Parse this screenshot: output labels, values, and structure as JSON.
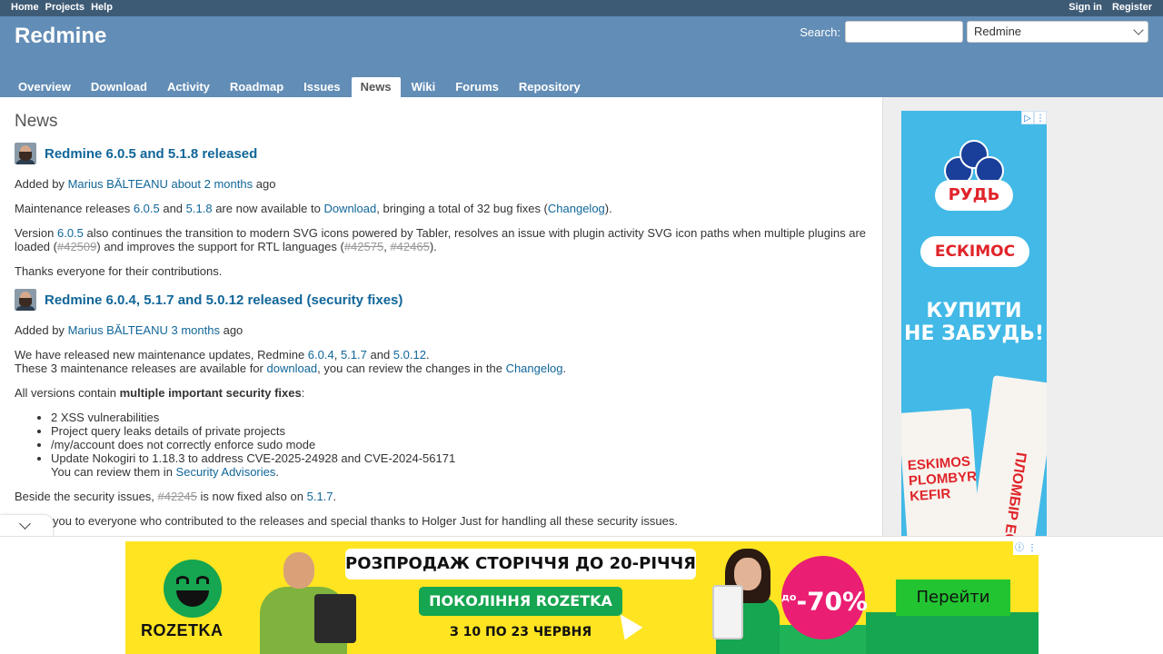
{
  "top_menu": {
    "left": [
      "Home",
      "Projects",
      "Help"
    ],
    "right": [
      "Sign in",
      "Register"
    ]
  },
  "header": {
    "title": "Redmine",
    "search_label": "Search:",
    "search_value": "",
    "project_select": "Redmine"
  },
  "main_menu": {
    "tabs": [
      "Overview",
      "Download",
      "Activity",
      "Roadmap",
      "Issues",
      "News",
      "Wiki",
      "Forums",
      "Repository"
    ],
    "selected": "News"
  },
  "content": {
    "heading": "News",
    "news": [
      {
        "title": "Redmine 6.0.5 and 5.1.8 released",
        "added_by": "Added by",
        "author": "Marius BĂLTEANU",
        "age": "about 2 months",
        "ago": "ago",
        "p1": {
          "t1": "Maintenance releases ",
          "l1": "6.0.5",
          "t2": " and ",
          "l2": "5.1.8",
          "t3": " are now available to ",
          "l3": "Download",
          "t4": ", bringing a total of 32 bug fixes (",
          "l4": "Changelog",
          "t5": ")."
        },
        "p2": {
          "t1": "Version ",
          "l1": "6.0.5",
          "t2": " also continues the transition to modern SVG icons powered by Tabler, resolves an issue with plugin activity SVG icon paths when multiple plugins are loaded (",
          "i1": "#42509",
          "t3": ") and improves the support for RTL languages (",
          "i2": "#42575",
          "t4": ", ",
          "i3": "#42465",
          "t5": ")."
        },
        "p3": "Thanks everyone for their contributions."
      },
      {
        "title": "Redmine 6.0.4, 5.1.7 and 5.0.12 released (security fixes)",
        "added_by": "Added by",
        "author": "Marius BĂLTEANU",
        "age": "3 months",
        "ago": "ago",
        "p1": {
          "t1": "We have released new maintenance updates, Redmine ",
          "l1": "6.0.4",
          "t2": ", ",
          "l2": "5.1.7",
          "t3": " and ",
          "l3": "5.0.12",
          "t4": ".",
          "t5": "These 3 maintenance releases are available for ",
          "l4": "download",
          "t6": ", you can review the changes in the ",
          "l5": "Changelog",
          "t7": "."
        },
        "p2": {
          "t1": "All versions contain ",
          "b1": "multiple important security fixes",
          "t2": ":"
        },
        "list": [
          "2 XSS vulnerabilities",
          "Project query leaks details of private projects",
          "/my/account does not correctly enforce sudo mode",
          "Update Nokogiri to 1.18.3 to address CVE-2025-24928 and CVE-2024-56171"
        ],
        "list_extra": {
          "t1": "You can review them in ",
          "l1": "Security Advisories",
          "t2": "."
        },
        "p3": {
          "t1": "Beside the security issues, ",
          "i1": "#42245",
          "t2": " is now fixed also on ",
          "l1": "5.1.7",
          "t3": "."
        },
        "p4": "you to everyone who contributed to the releases and special thanks to Holger Just for handling all these security issues."
      }
    ]
  },
  "side_ad": {
    "brand": "РУДЬ",
    "product": "ЕСКІМОС",
    "slogan_line1": "КУПИТИ",
    "slogan_line2": "НЕ ЗАБУДЬ!",
    "pack1_text": "ESKIMOS PLOMBYR KEFIR",
    "pack2_text": "ПЛОМБІР ЕСКІМОС"
  },
  "bottom_ad": {
    "brand": "ROZETKA",
    "headline": "РОЗПРОДАЖ СТОРІЧЧЯ ДО 20-РІЧЧЯ",
    "pill": "ПОКОЛІННЯ ROZETKA",
    "dates": "З 10 ПО 23 ЧЕРВНЯ",
    "discount_prefix": "до",
    "discount": "-70%",
    "cta": "Перейти"
  },
  "colors": {
    "top_menu_bg": "#3e5b76",
    "header_bg": "#628db6",
    "link": "#116699",
    "sidebar_bg": "#eeeeee",
    "ad_yellow": "#ffe422",
    "ad_green": "#16a550",
    "ad_pink": "#ea1e73"
  }
}
